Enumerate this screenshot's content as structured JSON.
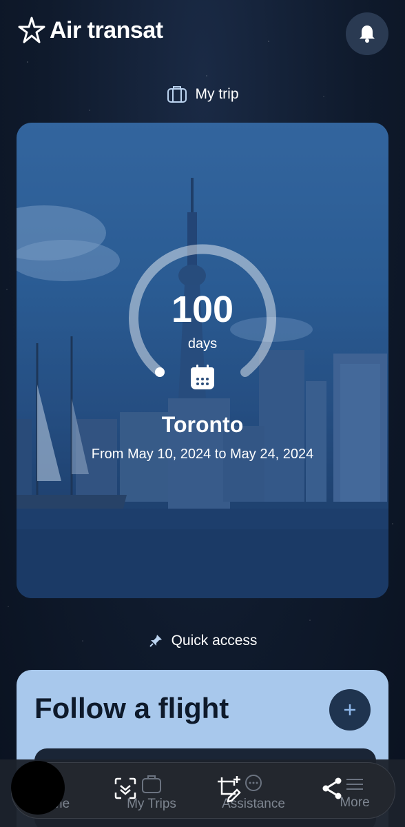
{
  "app": {
    "brand": "Air transat"
  },
  "header": {
    "notifications_icon": "bell-icon"
  },
  "my_trip": {
    "section_title": "My trip",
    "countdown_value": "100",
    "countdown_unit": "days",
    "destination": "Toronto",
    "date_range": "From May 10, 2024 to May 24, 2024"
  },
  "quick_access": {
    "section_title": "Quick access",
    "follow_flight_title": "Follow a flight"
  },
  "bottom_nav": {
    "items": [
      {
        "label": "Home",
        "icon": "home-icon"
      },
      {
        "label": "My Trips",
        "icon": "suitcase-icon"
      },
      {
        "label": "Assistance",
        "icon": "chat-icon"
      },
      {
        "label": "More",
        "icon": "menu-icon"
      }
    ],
    "home_partial_label": "me"
  },
  "colors": {
    "follow_card_bg": "#a8c8ec",
    "accent_button": "#1f344f",
    "add_icon": "#8fb8ea"
  }
}
